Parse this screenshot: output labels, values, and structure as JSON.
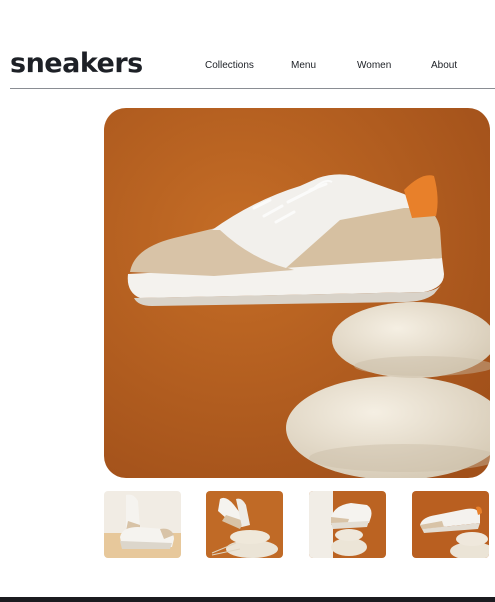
{
  "brand": {
    "logo_text": "sneakers"
  },
  "nav": {
    "items": [
      {
        "label": "Collections"
      },
      {
        "label": "Menu"
      },
      {
        "label": "Women"
      },
      {
        "label": "About"
      }
    ]
  },
  "gallery": {
    "hero": {
      "alt": "sneaker-balanced-on-stones"
    },
    "thumbnails": [
      {
        "alt": "sneaker-pair-on-tan-background"
      },
      {
        "alt": "sneaker-on-stones"
      },
      {
        "alt": "sneaker-on-stones-orange"
      },
      {
        "alt": "sneaker-side-on-stones"
      }
    ]
  },
  "colors": {
    "accent_orange": "#b9611f",
    "text_dark": "#1d2026",
    "stone": "#e9e2d4",
    "sole_white": "#f4f2ee",
    "suede_beige": "#d8c3a7",
    "heel_orange": "#e8802a"
  }
}
